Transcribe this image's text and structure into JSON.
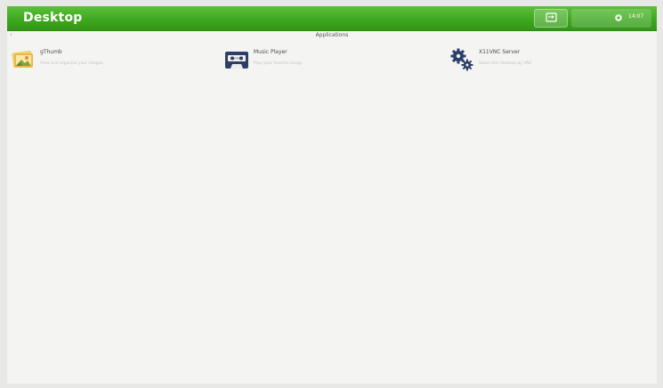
{
  "topbar": {
    "title": "Desktop",
    "clock": "14:07",
    "colors": {
      "bar": "#3fa820",
      "title_text": "#ffffff"
    },
    "switch_icon": "window-switch-icon",
    "tray_icon": "settings-gear-icon"
  },
  "main": {
    "back_icon": "back-arrow-icon",
    "back_glyph": "‹",
    "section_title": "Applications",
    "apps": [
      {
        "name": "gThumb",
        "description": "View and organize your images",
        "icon": "image-viewer-icon"
      },
      {
        "name": "Music Player",
        "description": "Play your favorite songs",
        "icon": "cassette-tape-icon"
      },
      {
        "name": "X11VNC Server",
        "description": "Share this desktop by VNC",
        "icon": "gears-icon"
      }
    ]
  }
}
